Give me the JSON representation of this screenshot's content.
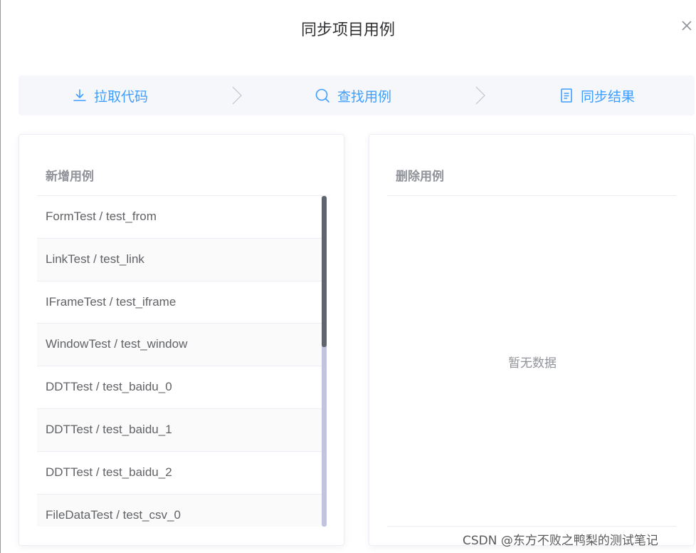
{
  "dialog": {
    "title": "同步项目用例"
  },
  "steps": [
    {
      "label": "拉取代码",
      "icon": "download-icon"
    },
    {
      "label": "查找用例",
      "icon": "search-icon"
    },
    {
      "label": "同步结果",
      "icon": "document-icon"
    }
  ],
  "accent_color": "#409eff",
  "added_panel": {
    "title": "新增用例",
    "items": [
      "FormTest / test_from",
      "LinkTest / test_link",
      "IFrameTest / test_iframe",
      "WindowTest / test_window",
      "DDTTest / test_baidu_0",
      "DDTTest / test_baidu_1",
      "DDTTest / test_baidu_2",
      "FileDataTest / test_csv_0"
    ]
  },
  "deleted_panel": {
    "title": "删除用例",
    "empty_text": "暂无数据"
  },
  "watermark": "CSDN @东方不败之鸭梨的测试笔记"
}
